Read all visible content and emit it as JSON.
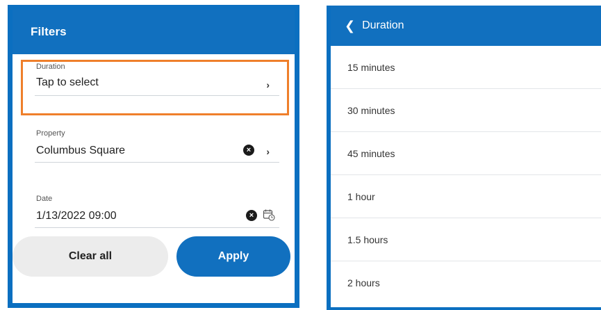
{
  "filters": {
    "title": "Filters",
    "duration": {
      "label": "Duration",
      "value": "Tap to select"
    },
    "property": {
      "label": "Property",
      "value": "Columbus Square"
    },
    "date": {
      "label": "Date",
      "value": "1/13/2022 09:00"
    },
    "buttons": {
      "clear_all": "Clear all",
      "apply": "Apply"
    }
  },
  "duration_panel": {
    "title": "Duration",
    "options": [
      "15 minutes",
      "30 minutes",
      "45 minutes",
      "1 hour",
      "1.5 hours",
      "2 hours"
    ]
  },
  "icons": {
    "chevron": "chevron-right-icon",
    "clear": "clear-x-icon",
    "calendar": "calendar-icon",
    "back": "chevron-left-icon"
  },
  "colors": {
    "brand_blue": "#1170bf",
    "highlight_orange": "#ef7f2b",
    "clear_button_bg": "#ececec"
  }
}
